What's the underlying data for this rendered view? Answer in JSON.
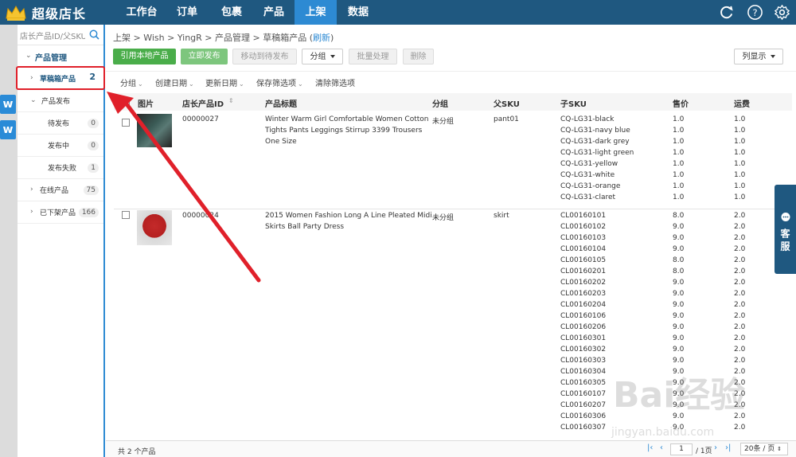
{
  "app": {
    "brand": "超级店长"
  },
  "nav": [
    {
      "label": "工作台",
      "active": false
    },
    {
      "label": "订单",
      "active": false
    },
    {
      "label": "包裹",
      "active": false
    },
    {
      "label": "产品",
      "active": false
    },
    {
      "label": "上架",
      "active": true
    },
    {
      "label": "数据",
      "active": false
    }
  ],
  "sidebar": {
    "search_placeholder": "店长产品ID/父SKU",
    "group": "产品管理",
    "items": [
      {
        "label": "草稿箱产品",
        "count": "2"
      },
      {
        "label": "产品发布"
      },
      {
        "label": "待发布",
        "count": "0"
      },
      {
        "label": "发布中",
        "count": "0"
      },
      {
        "label": "发布失败",
        "count": "1"
      },
      {
        "label": "在线产品",
        "count": "75"
      },
      {
        "label": "已下架产品",
        "count": "166"
      }
    ]
  },
  "crumb": {
    "path": "上架 > Wish > YingR > 产品管理 > 草稿箱产品 (",
    "refresh": "刷新",
    "close": ")"
  },
  "toolbar": {
    "btn1": "引用本地产品",
    "btn2": "立即发布",
    "btn3": "移动到待发布",
    "btn4": "分组",
    "btn5": "批量处理",
    "btn6": "删除",
    "btn7": "列显示"
  },
  "filters": [
    "分组",
    "创建日期",
    "更新日期",
    "保存筛选项",
    "清除筛选项"
  ],
  "table": {
    "headers": [
      "图片",
      "店长产品ID",
      "产品标题",
      "分组",
      "父SKU",
      "子SKU",
      "售价",
      "运费"
    ],
    "rows": [
      {
        "id": "00000027",
        "title": "Winter Warm Girl Comfortable Women Cotton Tights Pants Leggings Stirrup 3399 Trousers One Size",
        "group": "未分组",
        "parent": "pant01",
        "skus": [
          "CQ-LG31-black",
          "CQ-LG31-navy blue",
          "CQ-LG31-dark grey",
          "CQ-LG31-light green",
          "CQ-LG31-yellow",
          "CQ-LG31-white",
          "CQ-LG31-orange",
          "CQ-LG31-claret"
        ],
        "prices": [
          "1.0",
          "1.0",
          "1.0",
          "1.0",
          "1.0",
          "1.0",
          "1.0",
          "1.0"
        ],
        "ship": [
          "1.0",
          "1.0",
          "1.0",
          "1.0",
          "1.0",
          "1.0",
          "1.0",
          "1.0"
        ]
      },
      {
        "id": "00000024",
        "title": "2015 Women Fashion Long A Line Pleated Midi Skirts Ball Party Dress",
        "group": "未分组",
        "parent": "skirt",
        "skus": [
          "CL00160101",
          "CL00160102",
          "CL00160103",
          "CL00160104",
          "CL00160105",
          "CL00160201",
          "CL00160202",
          "CL00160203",
          "CL00160204",
          "CL00160106",
          "CL00160206",
          "CL00160301",
          "CL00160302",
          "CL00160303",
          "CL00160304",
          "CL00160305",
          "CL00160107",
          "CL00160207",
          "CL00160306",
          "CL00160307"
        ],
        "prices": [
          "8.0",
          "9.0",
          "9.0",
          "9.0",
          "8.0",
          "8.0",
          "9.0",
          "9.0",
          "9.0",
          "9.0",
          "9.0",
          "9.0",
          "9.0",
          "9.0",
          "9.0",
          "9.0",
          "9.0",
          "9.0",
          "9.0",
          "9.0"
        ],
        "ship": [
          "2.0",
          "2.0",
          "2.0",
          "2.0",
          "2.0",
          "2.0",
          "2.0",
          "2.0",
          "2.0",
          "2.0",
          "2.0",
          "2.0",
          "2.0",
          "2.0",
          "2.0",
          "2.0",
          "2.0",
          "2.0",
          "2.0",
          "2.0"
        ]
      }
    ]
  },
  "footer": {
    "total": "共 2 个产品",
    "page": "1",
    "page_of": "/ 1页",
    "page_size": "20条 / 页"
  },
  "kefu": "客服",
  "watermark": {
    "main": "Bai经验",
    "sub": "jingyan.baidu.com"
  },
  "colors": {
    "topbar": "#1f5880",
    "active": "#2d8ad3",
    "green": "#4aad4a",
    "annotation": "#e0202a"
  }
}
